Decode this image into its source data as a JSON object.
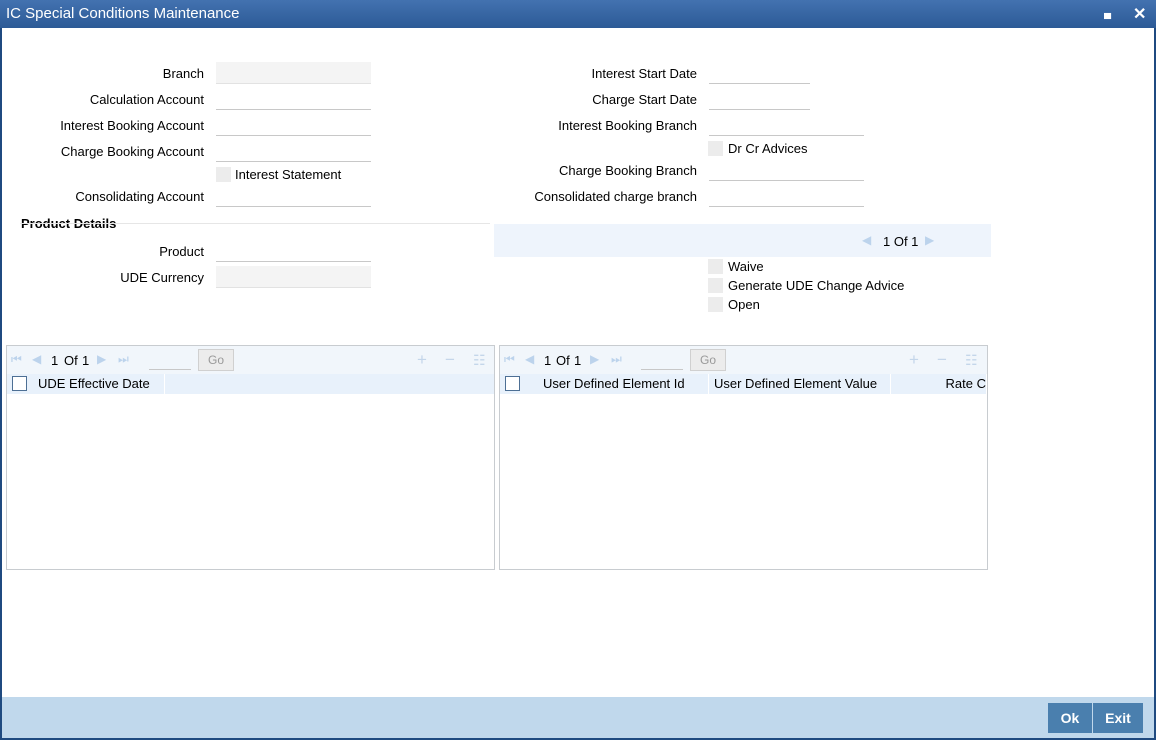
{
  "window": {
    "title": "IC Special Conditions Maintenance",
    "minimize": "▄",
    "close": "✕"
  },
  "form_left": {
    "branch": "Branch",
    "calculation_account": "Calculation Account",
    "interest_booking_account": "Interest Booking Account",
    "charge_booking_account": "Charge Booking Account",
    "interest_statement": "Interest Statement",
    "consolidating_account": "Consolidating Account"
  },
  "form_right": {
    "interest_start_date": "Interest Start Date",
    "charge_start_date": "Charge Start Date",
    "interest_booking_branch": "Interest Booking Branch",
    "dr_cr_advices": "Dr Cr Advices",
    "charge_booking_branch": "Charge Booking Branch",
    "consolidated_charge_branch": "Consolidated charge branch"
  },
  "product": {
    "section": "Product Details",
    "product": "Product",
    "ude_currency": "UDE Currency",
    "pager": "1 Of 1",
    "waive": "Waive",
    "generate_ude_change_advice": "Generate UDE Change Advice",
    "open": "Open"
  },
  "grid_left": {
    "page": "1",
    "of": "Of",
    "total": "1",
    "go": "Go",
    "columns": [
      "UDE Effective Date"
    ]
  },
  "grid_right": {
    "page": "1",
    "of": "Of",
    "total": "1",
    "go": "Go",
    "columns": [
      "User Defined Element Id",
      "User Defined Element Value",
      "Rate C"
    ]
  },
  "footer": {
    "ok": "Ok",
    "exit": "Exit"
  }
}
